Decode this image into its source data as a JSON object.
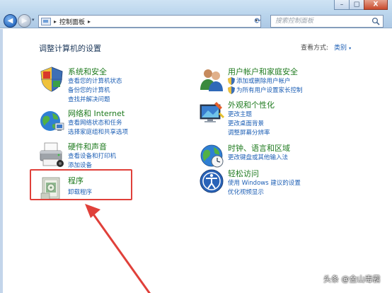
{
  "window": {
    "minimize_label": "–",
    "maximize_label": "□",
    "close_label": "X"
  },
  "nav": {
    "back_arrow": "◀",
    "forward_arrow": "▶",
    "dropdown_caret": "▾"
  },
  "address": {
    "separator": "▸",
    "path": "控制面板",
    "path_separator": "▸",
    "caret": "▾"
  },
  "search": {
    "placeholder": "搜索控制面板"
  },
  "header": {
    "title": "调整计算机的设置",
    "view_by_label": "查看方式:",
    "view_by_value": "类别",
    "view_by_caret": "▾"
  },
  "categories": [
    {
      "id": "system-security",
      "title": "系统和安全",
      "icon": "shield-flag-icon",
      "links": [
        "查看您的计算机状态",
        "备份您的计算机",
        "查找并解决问题"
      ]
    },
    {
      "id": "network",
      "title": "网络和 Internet",
      "icon": "globe-network-icon",
      "links": [
        "查看网络状态和任务",
        "选择家庭组和共享选项"
      ]
    },
    {
      "id": "hardware-sound",
      "title": "硬件和声音",
      "icon": "printer-icon",
      "links": [
        "查看设备和打印机",
        "添加设备"
      ]
    },
    {
      "id": "programs",
      "title": "程序",
      "icon": "programs-icon",
      "links": [
        "卸载程序"
      ]
    },
    {
      "id": "user-accounts",
      "title": "用户帐户和家庭安全",
      "icon": "users-icon",
      "links": [
        "添加或删除用户帐户",
        "为所有用户设置家长控制"
      ]
    },
    {
      "id": "appearance",
      "title": "外观和个性化",
      "icon": "display-icon",
      "links": [
        "更改主题",
        "更改桌面背景",
        "调整屏幕分辨率"
      ]
    },
    {
      "id": "clock-region",
      "title": "时钟、语言和区域",
      "icon": "clock-globe-icon",
      "links": [
        "更改键盘或其他输入法"
      ]
    },
    {
      "id": "ease-of-access",
      "title": "轻松访问",
      "icon": "accessibility-icon",
      "links": [
        "使用 Windows 建议的设置",
        "优化视频显示"
      ]
    }
  ],
  "colors": {
    "category_title": "#1e7a1e",
    "link": "#1d5fb5",
    "highlight": "#e0403a"
  },
  "watermark": "头条 @金山毒霸"
}
